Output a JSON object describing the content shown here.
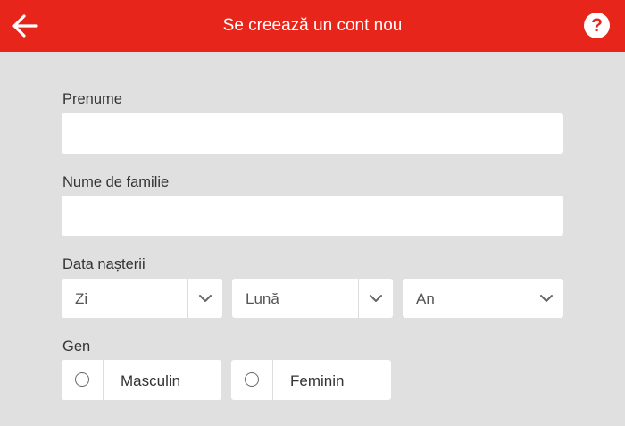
{
  "colors": {
    "header_bg": "#e8251b",
    "page_bg": "#e0e0e0",
    "field_bg": "#ffffff"
  },
  "header": {
    "title": "Se creează un cont nou",
    "back_icon": "arrow-left-icon",
    "help_icon": "question-mark-icon",
    "help_glyph": "?"
  },
  "form": {
    "first_name": {
      "label": "Prenume",
      "value": "",
      "placeholder": ""
    },
    "last_name": {
      "label": "Nume de familie",
      "value": "",
      "placeholder": ""
    },
    "birth_date": {
      "label": "Data nașterii",
      "day": "Zi",
      "month": "Lună",
      "year": "An"
    },
    "gender": {
      "label": "Gen",
      "options": [
        "Masculin",
        "Feminin"
      ],
      "selected": null
    }
  }
}
